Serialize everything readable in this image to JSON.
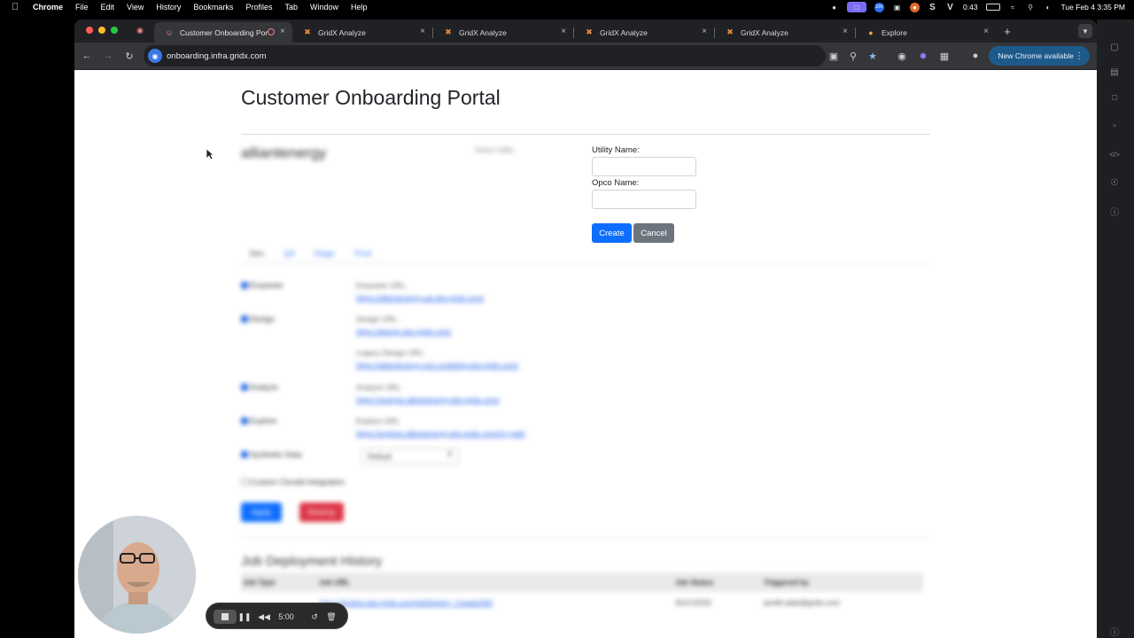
{
  "menubar": {
    "app": "Chrome",
    "items": [
      "File",
      "Edit",
      "View",
      "History",
      "Bookmarks",
      "Profiles",
      "Tab",
      "Window",
      "Help"
    ],
    "timer": "0:43",
    "datetime": "Tue Feb 4  3:35 PM"
  },
  "tabs": [
    {
      "label": "Customer Onboarding Por"
    },
    {
      "label": "GridX Analyze"
    },
    {
      "label": "GridX Analyze"
    },
    {
      "label": "GridX Analyze"
    },
    {
      "label": "GridX Analyze"
    },
    {
      "label": "Explore"
    }
  ],
  "toolbar": {
    "url": "onboarding.infra.gridx.com",
    "new_chrome": "New Chrome available"
  },
  "page": {
    "title": "Customer Onboarding Portal",
    "utility_display": "alliantenergy",
    "select_hint": "Select Utility",
    "utility_name_label": "Utility Name:",
    "opco_name_label": "Opco Name:",
    "utility_name_value": "",
    "opco_name_value": "",
    "create_label": "Create",
    "cancel_label": "Cancel",
    "env_tabs": [
      "Dev",
      "QA",
      "Stage",
      "Prod"
    ],
    "rows": [
      {
        "label": "Empower",
        "url_label": "Empower URL:",
        "url": "https://alliantenergy.uat.dev.gridx.com/"
      },
      {
        "label": "Design",
        "url_label": "Design URL:",
        "url": "https://design.dev.gridx.com/"
      },
      {
        "label": "",
        "url_label": "Legacy Design URL:",
        "url": "https://alliantenergy.qa1.modeling.dev.gridx.com/"
      },
      {
        "label": "Analyze",
        "url_label": "Analyze URL:",
        "url": "https://analyze.alliantenergy.dev.gridx.com/"
      },
      {
        "label": "Explore",
        "url_label": "Explore URL:",
        "url": "https://explore.alliantenergy.dev.gridx.com/my-path"
      },
      {
        "label": "Synthetic Data",
        "url_label": "",
        "url": ""
      }
    ],
    "select_value": "Default",
    "custom_label": "Custom Cloudd Integration",
    "apply_label": "Apply",
    "destroy_label": "Destroy",
    "job_title": "Job Deployment History",
    "table_headers": [
      "Job Type",
      "Job URL",
      "Job Status",
      "Triggered by"
    ],
    "table_row": [
      "",
      "https://jenkins.dev.gridx.com/job/Deploy_Create/263",
      "SUCCESS",
      "jsmith.dale@gridx.com"
    ]
  },
  "recorder": {
    "time": "5:00"
  }
}
